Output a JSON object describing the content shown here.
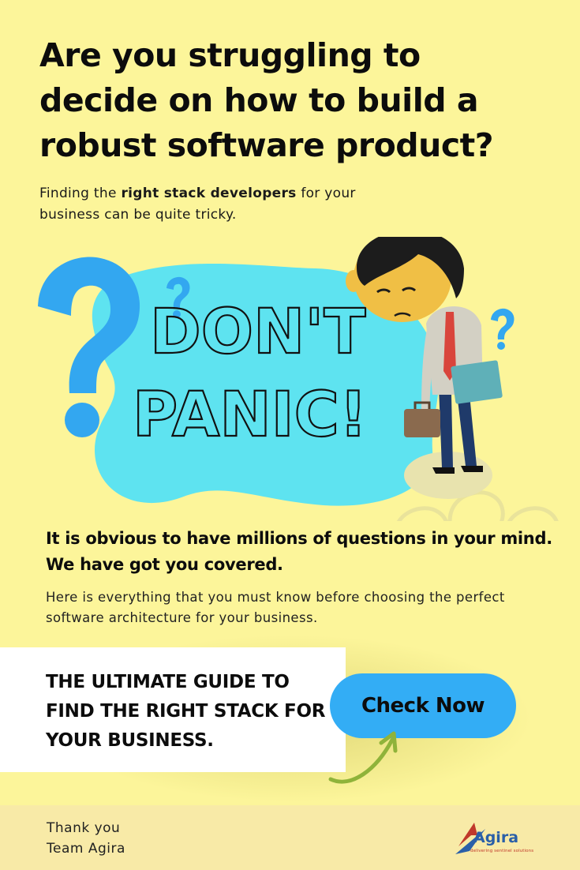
{
  "headline": "Are you struggling to decide on how to build a robust software product?",
  "intro": {
    "before": "Finding the ",
    "bold": "right stack developers",
    "after": " for your business can be quite tricky."
  },
  "panic": {
    "line1": "DON'T",
    "line2": "PANIC!"
  },
  "obvious_text": "It is obvious to have millions of questions in your mind. We have got you covered.",
  "here_text": "Here is everything that you must know before choosing the perfect software architecture for your business.",
  "guide_title": "THE ULTIMATE GUIDE TO FIND THE RIGHT STACK FOR YOUR BUSINESS.",
  "cta_label": "Check Now",
  "footer": {
    "line1": "Thank you",
    "line2": "Team Agira"
  },
  "logo": {
    "name": "Agira",
    "tagline": "delivering sentinel solutions"
  },
  "colors": {
    "background": "#fcf59a",
    "blob": "#5ee3f0",
    "question_blue": "#33a7f0",
    "button": "#33adf5",
    "arrow": "#8fb33a",
    "tie": "#d9453c"
  },
  "icons": [
    "question-mark-icon",
    "person-illustration",
    "briefcase-icon",
    "folder-icon",
    "curved-arrow-icon",
    "agira-logo"
  ]
}
